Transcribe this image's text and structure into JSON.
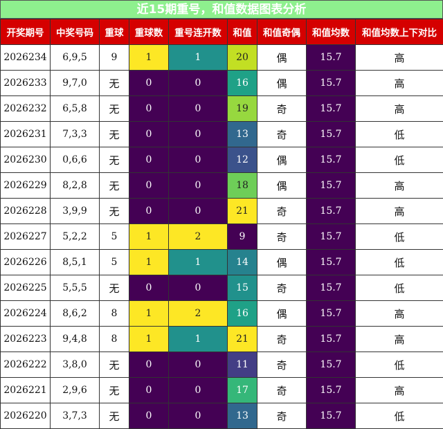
{
  "title": "近15期重号，和值数据图表分析",
  "headers": [
    "开奖期号",
    "中奖号码",
    "重球",
    "重球数",
    "重号连开数",
    "和值",
    "和值奇偶",
    "和值均数",
    "和值均数上下对比"
  ],
  "colors": {
    "title_bg": "#8ef08e",
    "header_bg": "#d50000",
    "purple": "#440154",
    "yellow": "#fde725",
    "teal": "#21918c",
    "sum_scale": {
      "9": "#440154",
      "11": "#433e85",
      "12": "#3b528b",
      "13": "#31688e",
      "14": "#26828e",
      "15": "#21918c",
      "16": "#1fa187",
      "17": "#35b779",
      "18": "#6ece58",
      "19": "#97d83f",
      "20": "#c2df23",
      "21": "#fde725"
    }
  },
  "rows": [
    {
      "period": "2026234",
      "numbers": "6,9,5",
      "repeat": "9",
      "repeat_count": "1",
      "consecutive": "1",
      "sum": "20",
      "parity": "偶",
      "avg": "15.7",
      "compare": "高"
    },
    {
      "period": "2026233",
      "numbers": "9,7,0",
      "repeat": "无",
      "repeat_count": "0",
      "consecutive": "0",
      "sum": "16",
      "parity": "偶",
      "avg": "15.7",
      "compare": "高"
    },
    {
      "period": "2026232",
      "numbers": "6,5,8",
      "repeat": "无",
      "repeat_count": "0",
      "consecutive": "0",
      "sum": "19",
      "parity": "奇",
      "avg": "15.7",
      "compare": "高"
    },
    {
      "period": "2026231",
      "numbers": "7,3,3",
      "repeat": "无",
      "repeat_count": "0",
      "consecutive": "0",
      "sum": "13",
      "parity": "奇",
      "avg": "15.7",
      "compare": "低"
    },
    {
      "period": "2026230",
      "numbers": "0,6,6",
      "repeat": "无",
      "repeat_count": "0",
      "consecutive": "0",
      "sum": "12",
      "parity": "偶",
      "avg": "15.7",
      "compare": "低"
    },
    {
      "period": "2026229",
      "numbers": "8,2,8",
      "repeat": "无",
      "repeat_count": "0",
      "consecutive": "0",
      "sum": "18",
      "parity": "偶",
      "avg": "15.7",
      "compare": "高"
    },
    {
      "period": "2026228",
      "numbers": "3,9,9",
      "repeat": "无",
      "repeat_count": "0",
      "consecutive": "0",
      "sum": "21",
      "parity": "奇",
      "avg": "15.7",
      "compare": "高"
    },
    {
      "period": "2026227",
      "numbers": "5,2,2",
      "repeat": "5",
      "repeat_count": "1",
      "consecutive": "2",
      "sum": "9",
      "parity": "奇",
      "avg": "15.7",
      "compare": "低"
    },
    {
      "period": "2026226",
      "numbers": "8,5,1",
      "repeat": "5",
      "repeat_count": "1",
      "consecutive": "1",
      "sum": "14",
      "parity": "偶",
      "avg": "15.7",
      "compare": "低"
    },
    {
      "period": "2026225",
      "numbers": "5,5,5",
      "repeat": "无",
      "repeat_count": "0",
      "consecutive": "0",
      "sum": "15",
      "parity": "奇",
      "avg": "15.7",
      "compare": "低"
    },
    {
      "period": "2026224",
      "numbers": "8,6,2",
      "repeat": "8",
      "repeat_count": "1",
      "consecutive": "2",
      "sum": "16",
      "parity": "偶",
      "avg": "15.7",
      "compare": "高"
    },
    {
      "period": "2026223",
      "numbers": "9,4,8",
      "repeat": "8",
      "repeat_count": "1",
      "consecutive": "1",
      "sum": "21",
      "parity": "奇",
      "avg": "15.7",
      "compare": "高"
    },
    {
      "period": "2026222",
      "numbers": "3,8,0",
      "repeat": "无",
      "repeat_count": "0",
      "consecutive": "0",
      "sum": "11",
      "parity": "奇",
      "avg": "15.7",
      "compare": "低"
    },
    {
      "period": "2026221",
      "numbers": "2,9,6",
      "repeat": "无",
      "repeat_count": "0",
      "consecutive": "0",
      "sum": "17",
      "parity": "奇",
      "avg": "15.7",
      "compare": "高"
    },
    {
      "period": "2026220",
      "numbers": "3,7,3",
      "repeat": "无",
      "repeat_count": "0",
      "consecutive": "0",
      "sum": "13",
      "parity": "奇",
      "avg": "15.7",
      "compare": "低"
    }
  ]
}
